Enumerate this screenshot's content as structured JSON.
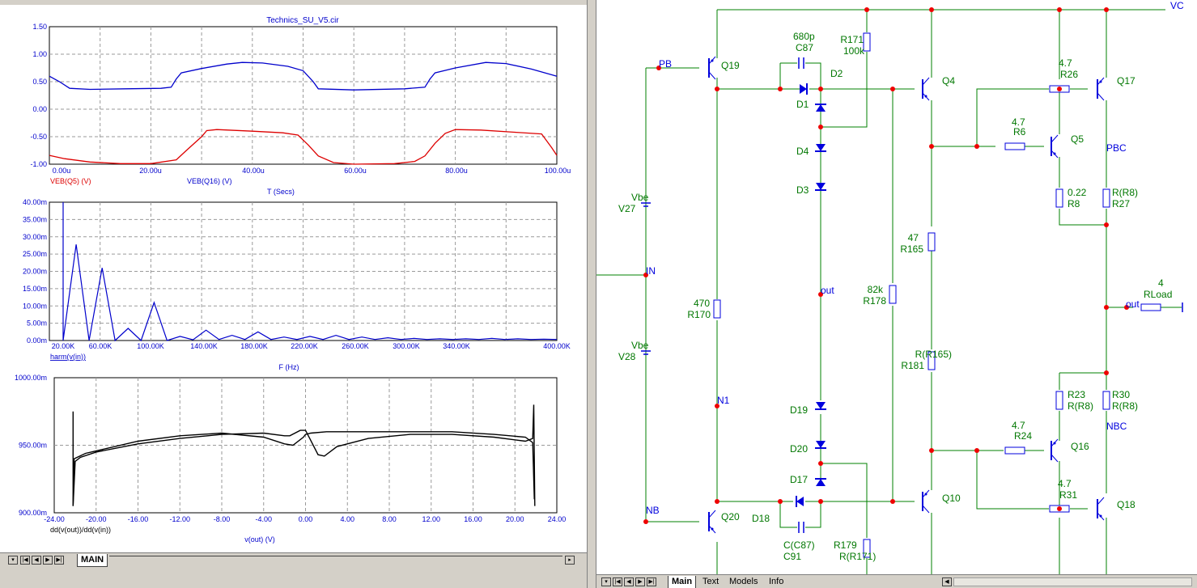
{
  "colors": {
    "red": "#dd0000",
    "blue": "#0000cc",
    "green": "#008000",
    "grid": "#9a9a9a",
    "dot": "#ee0000",
    "wire": "#007700",
    "comp": "#0000dd"
  },
  "top_plot": {
    "title": "Technics_SU_V5.cir",
    "y_ticks": [
      "1.50",
      "1.00",
      "0.50",
      "0.00",
      "-0.50",
      "-1.00"
    ],
    "x_ticks": [
      "0.00u",
      "20.00u",
      "40.00u",
      "60.00u",
      "80.00u",
      "100.00u"
    ],
    "trace_red": "VEB(Q5) (V)",
    "trace_blue": "VEB(Q16) (V)",
    "xlabel": "T (Secs)"
  },
  "mid_plot": {
    "y_ticks": [
      "40.00m",
      "35.00m",
      "30.00m",
      "25.00m",
      "20.00m",
      "15.00m",
      "10.00m",
      "5.00m",
      "0.00m"
    ],
    "x_ticks": [
      "20.00K",
      "60.00K",
      "100.00K",
      "140.00K",
      "180.00K",
      "220.00K",
      "260.00K",
      "300.00K",
      "340.00K",
      "400.00K"
    ],
    "trace": "harm(v(in))",
    "xlabel": "F (Hz)"
  },
  "bot_plot": {
    "y_ticks": [
      "1000.00m",
      "950.00m",
      "900.00m"
    ],
    "x_ticks": [
      "-24.00",
      "-20.00",
      "-16.00",
      "-12.00",
      "-8.00",
      "-4.00",
      "0.00",
      "4.00",
      "8.00",
      "12.00",
      "16.00",
      "20.00",
      "24.00"
    ],
    "trace": "dd(v(out))/dd(v(in))",
    "xlabel": "v(out) (V)"
  },
  "left_tabs": [
    "MAIN"
  ],
  "right_tabs": [
    "Main",
    "Text",
    "Models",
    "Info"
  ],
  "schematic": {
    "nodes": [
      "VC",
      "PB",
      "IN",
      "out",
      "N1",
      "NB",
      "PBC",
      "NBC",
      "out"
    ],
    "parts": {
      "q19": "Q19",
      "q20": "Q20",
      "q4": "Q4",
      "q10": "Q10",
      "q5": "Q5",
      "q16": "Q16",
      "q17": "Q17",
      "q18": "Q18",
      "d1": "D1",
      "d2": "D2",
      "d3": "D3",
      "d4": "D4",
      "d17": "D17",
      "d18": "D18",
      "d19": "D19",
      "d20": "D20",
      "c87v": "680p",
      "c87": "C87",
      "c91v": "C(C87)",
      "c91": "C91",
      "r171v": "R171",
      "r171": "100k",
      "r26v": "4.7",
      "r26": "R26",
      "r6v": "4.7",
      "r6": "R6",
      "r8v": "0.22",
      "r8": "R8",
      "r27v": "R(R8)",
      "r27": "R27",
      "r165v": "47",
      "r165": "R165",
      "r178v": "82k",
      "r178": "R178",
      "r181v": "R(R165)",
      "r181": "R181",
      "r170v": "470",
      "r170": "R170",
      "v27v": "Vbe",
      "v27": "V27",
      "v28v": "Vbe",
      "v28": "V28",
      "rloadv": "4",
      "rload": "RLoad",
      "r23v": "R23",
      "r23": "R(R8)",
      "r30v": "R30",
      "r30": "R(R8)",
      "r24v": "4.7",
      "r24": "R24",
      "r31v": "4.7",
      "r31": "R31",
      "r179v": "R179",
      "r179": "R(R171)"
    }
  }
}
